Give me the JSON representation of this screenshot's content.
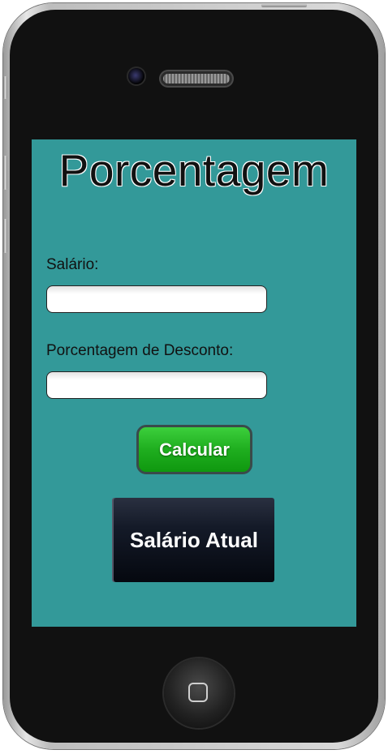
{
  "app": {
    "title": "Porcentagem"
  },
  "form": {
    "salary_label": "Salário:",
    "salary_value": "",
    "discount_label": "Porcentagem de Desconto:",
    "discount_value": "",
    "calculate_label": "Calcular",
    "result_label": "Salário Atual"
  },
  "colors": {
    "screen_background": "#339999",
    "calculate_button": "#1fae1f",
    "result_button": "#0a0f1a",
    "phone_frame": "#111111"
  },
  "icons": {
    "home": "home-button-square-icon"
  }
}
